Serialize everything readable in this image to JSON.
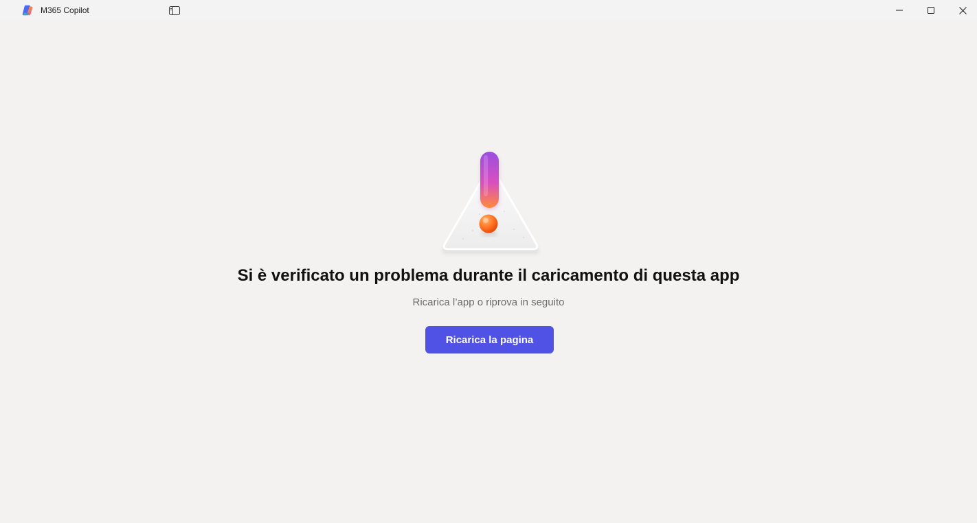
{
  "window": {
    "title": "M365 Copilot",
    "logo_icon": "copilot-logo-icon",
    "controls": {
      "sidebar_icon": "sidebar-toggle-icon",
      "minimize_icon": "minimize-icon",
      "maximize_icon": "maximize-icon",
      "close_icon": "close-icon"
    }
  },
  "error": {
    "illustration_icon": "warning-triangle-icon",
    "title": "Si è verificato un problema durante il caricamento di questa app",
    "subtitle": "Ricarica l’app o riprova in seguito",
    "reload_label": "Ricarica la pagina"
  },
  "colors": {
    "background": "#f3f2f1",
    "titlebar": "#f3f3f3",
    "accent": "#4f52e5",
    "title_text": "#111111",
    "subtitle_text": "#6b6b6b"
  }
}
